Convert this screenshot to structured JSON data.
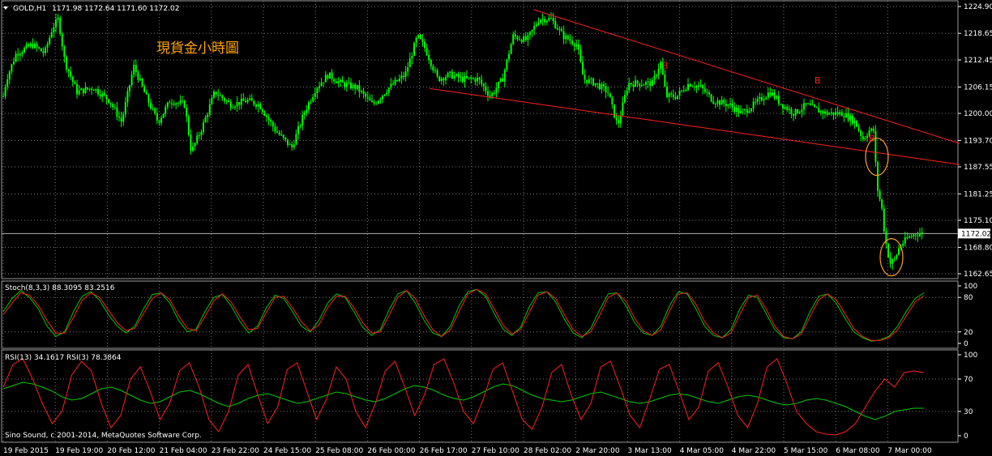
{
  "header": {
    "symbol": "GOLD,H1",
    "ohlc": "1171.98 1172.64 1171.60 1172.02"
  },
  "annotation": "現貨金小時圖",
  "copyright": "Sino Sound, c 2001-2014, MetaQuotes Software Corp.",
  "chart_data": [
    {
      "type": "candlestick",
      "title": "GOLD,H1",
      "ylim": [
        1162.65,
        1224.9
      ],
      "y_ticks": [
        "1224.90",
        "1218.65",
        "1212.45",
        "1206.15",
        "1200.00",
        "1193.70",
        "1187.55",
        "1181.25",
        "1175.10",
        "1168.80",
        "1162.65"
      ],
      "current_price": "1172.02",
      "x_ticks": [
        "19 Feb 2015",
        "19 Feb 19:00",
        "20 Feb 12:00",
        "21 Feb 04:00",
        "23 Feb 22:00",
        "24 Feb 15:00",
        "25 Feb 08:00",
        "26 Feb 00:00",
        "26 Feb 17:00",
        "27 Feb 10:00",
        "28 Feb 02:00",
        "2 Mar 20:00",
        "3 Mar 13:00",
        "4 Mar 05:00",
        "4 Mar 22:00",
        "5 Mar 15:00",
        "6 Mar 08:00",
        "7 Mar 00:00"
      ],
      "close_path": [
        [
          0,
          1200
        ],
        [
          8,
          1208
        ],
        [
          20,
          1214
        ],
        [
          40,
          1216
        ],
        [
          55,
          1214
        ],
        [
          65,
          1220
        ],
        [
          72,
          1222
        ],
        [
          80,
          1212
        ],
        [
          95,
          1205
        ],
        [
          115,
          1206
        ],
        [
          135,
          1203
        ],
        [
          150,
          1198
        ],
        [
          165,
          1211
        ],
        [
          180,
          1204
        ],
        [
          195,
          1198
        ],
        [
          210,
          1203
        ],
        [
          228,
          1202
        ],
        [
          236,
          1191
        ],
        [
          250,
          1197
        ],
        [
          265,
          1205
        ],
        [
          285,
          1202
        ],
        [
          305,
          1203
        ],
        [
          320,
          1202
        ],
        [
          340,
          1196
        ],
        [
          360,
          1192
        ],
        [
          375,
          1200
        ],
        [
          390,
          1206
        ],
        [
          405,
          1209
        ],
        [
          420,
          1207
        ],
        [
          440,
          1206
        ],
        [
          460,
          1202
        ],
        [
          480,
          1206
        ],
        [
          500,
          1209
        ],
        [
          515,
          1218
        ],
        [
          525,
          1215
        ],
        [
          540,
          1208
        ],
        [
          555,
          1209
        ],
        [
          570,
          1208
        ],
        [
          590,
          1208
        ],
        [
          605,
          1204
        ],
        [
          620,
          1208
        ],
        [
          633,
          1218
        ],
        [
          650,
          1217
        ],
        [
          665,
          1222
        ],
        [
          680,
          1222
        ],
        [
          695,
          1218
        ],
        [
          712,
          1216
        ],
        [
          720,
          1208
        ],
        [
          735,
          1207
        ],
        [
          750,
          1205
        ],
        [
          762,
          1197
        ],
        [
          775,
          1207
        ],
        [
          790,
          1207
        ],
        [
          805,
          1207
        ],
        [
          815,
          1212
        ],
        [
          822,
          1204
        ],
        [
          835,
          1204
        ],
        [
          850,
          1207
        ],
        [
          865,
          1206
        ],
        [
          880,
          1203
        ],
        [
          900,
          1202
        ],
        [
          915,
          1200
        ],
        [
          930,
          1202
        ],
        [
          950,
          1205
        ],
        [
          965,
          1202
        ],
        [
          980,
          1200
        ],
        [
          995,
          1202
        ],
        [
          1005,
          1201
        ],
        [
          1020,
          1200
        ],
        [
          1040,
          1200
        ],
        [
          1055,
          1198
        ],
        [
          1065,
          1194
        ],
        [
          1072,
          1196
        ],
        [
          1078,
          1196
        ],
        [
          1082,
          1183
        ],
        [
          1088,
          1178
        ],
        [
          1092,
          1171
        ],
        [
          1098,
          1165
        ],
        [
          1104,
          1166
        ],
        [
          1110,
          1169
        ],
        [
          1120,
          1171
        ],
        [
          1130,
          1172
        ],
        [
          1140,
          1172.02
        ]
      ],
      "trendlines": [
        {
          "from": [
            658,
            1224.2
          ],
          "to": [
            1184,
            1193.0
          ]
        },
        {
          "from": [
            530,
            1205.8
          ],
          "to": [
            1184,
            1188.1
          ]
        }
      ],
      "circles": [
        {
          "x": 1082,
          "y": 1189.9
        },
        {
          "x": 1100,
          "y": 1166.5
        }
      ],
      "markers": [
        {
          "label": "B",
          "x": 817,
          "y": 1210.5
        },
        {
          "label": "B",
          "x": 1005,
          "y": 1207
        },
        {
          "label": "B",
          "x": 1072,
          "y": 1193.5
        }
      ]
    },
    {
      "type": "line",
      "title": "Stoch(8,3,3) 88.3095 83.2516",
      "ylim": [
        0,
        100
      ],
      "y_ticks": [
        "100",
        "80",
        "20",
        "0"
      ],
      "series": [
        {
          "name": "Stoch main",
          "color": "#00c800",
          "values": [
            55,
            78,
            92,
            80,
            60,
            30,
            12,
            20,
            55,
            82,
            90,
            75,
            50,
            30,
            18,
            30,
            60,
            85,
            88,
            70,
            40,
            20,
            25,
            55,
            80,
            85,
            65,
            38,
            18,
            30,
            62,
            84,
            78,
            55,
            30,
            20,
            40,
            70,
            86,
            80,
            55,
            28,
            14,
            24,
            58,
            86,
            92,
            70,
            40,
            18,
            12,
            30,
            66,
            90,
            94,
            82,
            52,
            25,
            14,
            28,
            64,
            88,
            90,
            72,
            42,
            18,
            10,
            26,
            58,
            86,
            88,
            66,
            36,
            18,
            14,
            30,
            66,
            90,
            86,
            60,
            30,
            14,
            10,
            24,
            60,
            84,
            80,
            52,
            24,
            10,
            8,
            20,
            55,
            82,
            86,
            70,
            44,
            20,
            10,
            4,
            6,
            12,
            30,
            56,
            78,
            88
          ]
        },
        {
          "name": "Stoch signal",
          "color": "#ff2020",
          "values": [
            50,
            70,
            88,
            84,
            66,
            40,
            18,
            18,
            45,
            75,
            88,
            80,
            58,
            36,
            22,
            26,
            52,
            78,
            88,
            76,
            48,
            26,
            22,
            46,
            74,
            86,
            72,
            46,
            24,
            26,
            54,
            80,
            82,
            62,
            38,
            22,
            32,
            62,
            82,
            82,
            62,
            36,
            18,
            20,
            48,
            80,
            92,
            78,
            48,
            24,
            12,
            24,
            56,
            86,
            94,
            86,
            60,
            32,
            16,
            24,
            54,
            84,
            90,
            78,
            50,
            24,
            12,
            20,
            48,
            80,
            88,
            74,
            44,
            22,
            14,
            24,
            56,
            86,
            88,
            68,
            38,
            18,
            10,
            18,
            50,
            80,
            84,
            60,
            30,
            12,
            8,
            16,
            46,
            76,
            86,
            76,
            52,
            26,
            12,
            5,
            5,
            10,
            24,
            48,
            72,
            83
          ]
        }
      ]
    },
    {
      "type": "line",
      "title": "RSI(13) 34.1617  RSI(3) 78.3864",
      "ylim": [
        0,
        100
      ],
      "y_ticks": [
        "100",
        "70",
        "30",
        "0"
      ],
      "series": [
        {
          "name": "RSI(13)",
          "color": "#00c800",
          "values": [
            58,
            62,
            66,
            64,
            60,
            55,
            48,
            44,
            46,
            52,
            58,
            60,
            56,
            50,
            44,
            40,
            42,
            48,
            54,
            56,
            52,
            46,
            40,
            36,
            40,
            46,
            50,
            52,
            48,
            44,
            40,
            42,
            46,
            50,
            54,
            52,
            48,
            44,
            42,
            46,
            52,
            58,
            62,
            60,
            56,
            50,
            46,
            44,
            48,
            54,
            60,
            64,
            62,
            56,
            50,
            46,
            44,
            42,
            44,
            48,
            52,
            54,
            50,
            46,
            42,
            40,
            42,
            46,
            50,
            52,
            50,
            46,
            42,
            40,
            44,
            48,
            50,
            48,
            44,
            40,
            38,
            40,
            44,
            46,
            44,
            40,
            36,
            30,
            24,
            20,
            24,
            30,
            32,
            34,
            34
          ]
        },
        {
          "name": "RSI(3)",
          "color": "#ff2020",
          "values": [
            60,
            88,
            95,
            70,
            40,
            15,
            30,
            75,
            92,
            80,
            40,
            10,
            25,
            70,
            85,
            55,
            20,
            40,
            80,
            90,
            60,
            20,
            5,
            30,
            75,
            88,
            50,
            15,
            35,
            82,
            90,
            55,
            20,
            45,
            85,
            70,
            30,
            10,
            40,
            80,
            92,
            60,
            25,
            50,
            88,
            95,
            65,
            30,
            15,
            45,
            82,
            90,
            55,
            20,
            8,
            35,
            78,
            88,
            50,
            20,
            40,
            85,
            92,
            60,
            25,
            10,
            45,
            82,
            88,
            55,
            20,
            35,
            80,
            90,
            60,
            25,
            10,
            40,
            85,
            95,
            65,
            30,
            15,
            5,
            2,
            1,
            5,
            15,
            35,
            55,
            70,
            60,
            78,
            80,
            78
          ]
        }
      ],
      "levels": [
        70,
        30
      ]
    }
  ],
  "colors": {
    "background": "#000000",
    "candle": "#00ff00",
    "trendline": "#ff2020",
    "grid": "#7a7a7a",
    "axis_text": "#ffffff",
    "annotation": "#ffa500"
  }
}
